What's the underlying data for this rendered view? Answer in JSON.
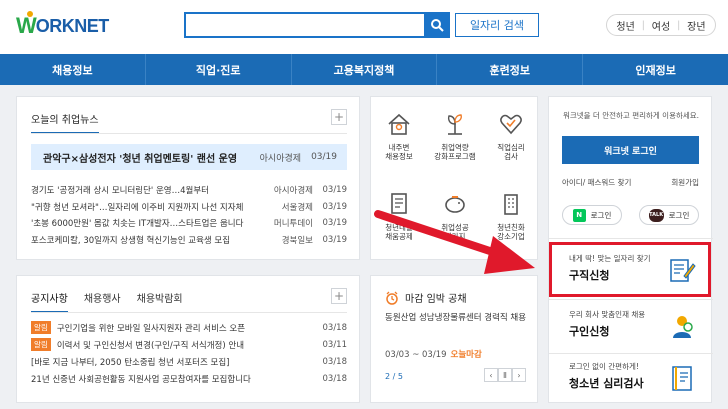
{
  "header": {
    "logo_w": "W",
    "logo_text": "ORKNET",
    "search_placeholder": "",
    "job_search_label": "일자리 검색",
    "user_links": [
      "청년",
      "여성",
      "장년"
    ]
  },
  "nav": [
    "채용정보",
    "직업·진로",
    "고용복지정책",
    "훈련정보",
    "인재정보"
  ],
  "news": {
    "tab": "오늘의 취업뉴스",
    "headline": {
      "title": "관악구×삼성전자 '청년 취업멘토링' 랜선 운영",
      "source": "아시아경제",
      "date": "03/19"
    },
    "rows": [
      {
        "title": "경기도 '공정거래 상시 모니터링단' 운영…4월부터",
        "source": "아시아경제",
        "date": "03/19"
      },
      {
        "title": "\"귀향 청년 모셔라\"…일자리에 이주비 지원까지 나선 지자체",
        "source": "서울경제",
        "date": "03/19"
      },
      {
        "title": "'초봉 6000만원' 몸값 치솟는 IT개발자…스타트업은 웁니다",
        "source": "머니투데이",
        "date": "03/19"
      },
      {
        "title": "포스코케미칼, 30일까지 상생형 혁신기능인 교육생 모집",
        "source": "경북일보",
        "date": "03/19"
      }
    ]
  },
  "notice": {
    "tabs": [
      "공지사항",
      "채용행사",
      "채용박람회"
    ],
    "rows": [
      {
        "badge": "알림",
        "title": "구인기업을 위한 모바일 일사지원자 관리 서비스 오픈",
        "date": "03/18"
      },
      {
        "badge": "알림",
        "title": "이력서 및 구인신청서 변경(구인/구직 서식개정) 안내",
        "date": "03/11"
      },
      {
        "badge": "",
        "title": "[바로 지금 나부터, 2050 탄소중립 청년 서포터즈 모집]",
        "date": "03/18"
      },
      {
        "badge": "",
        "title": "21년 신중년 사회공헌활동 지원사업 공모참여자를 모집합니다",
        "date": "03/18"
      }
    ]
  },
  "services": [
    {
      "icon": "house-icon",
      "label": "내주변\n채용정보"
    },
    {
      "icon": "plant-icon",
      "label": "취업역량\n강화프로그램"
    },
    {
      "icon": "heart-check-icon",
      "label": "직업심리\n검사"
    },
    {
      "icon": "document-icon",
      "label": "청년내일\n채움공제"
    },
    {
      "icon": "piggy-bank-icon",
      "label": "취업성공\n패키지"
    },
    {
      "icon": "building-icon",
      "label": "청년친화\n강소기업"
    }
  ],
  "deadline": {
    "title": "마감 임박 공채",
    "body": "동원산업  성남냉장물류센터 경력직 채용",
    "date": "03/03 ~ 03/19",
    "tag": "오늘마감",
    "page": "2 / 5"
  },
  "login": {
    "desc": "워크넷을 더 안전하고 편리하게 이용하세요.",
    "button": "워크넷 로그인",
    "find": "아이디/ 패스워드 찾기",
    "join": "회원가입",
    "naver": "로그인",
    "kakao": "로그인",
    "naver_icon_text": "N",
    "kakao_icon_text": "TALK"
  },
  "promos": [
    {
      "sub": "내게 딱! 맞는 일자리 찾기",
      "main": "구직신청",
      "icon": "resume-pen-icon"
    },
    {
      "sub": "우리 회사 맞춤인재 채용",
      "main": "구인신청",
      "icon": "recruit-person-icon"
    },
    {
      "sub": "로그인 없이 간편하게!",
      "main": "청소년 심리검사",
      "icon": "notebook-icon"
    }
  ],
  "colors": {
    "brand_blue": "#1b6bb5",
    "accent_orange": "#f07d2a",
    "highlight_red": "#e0192b"
  }
}
